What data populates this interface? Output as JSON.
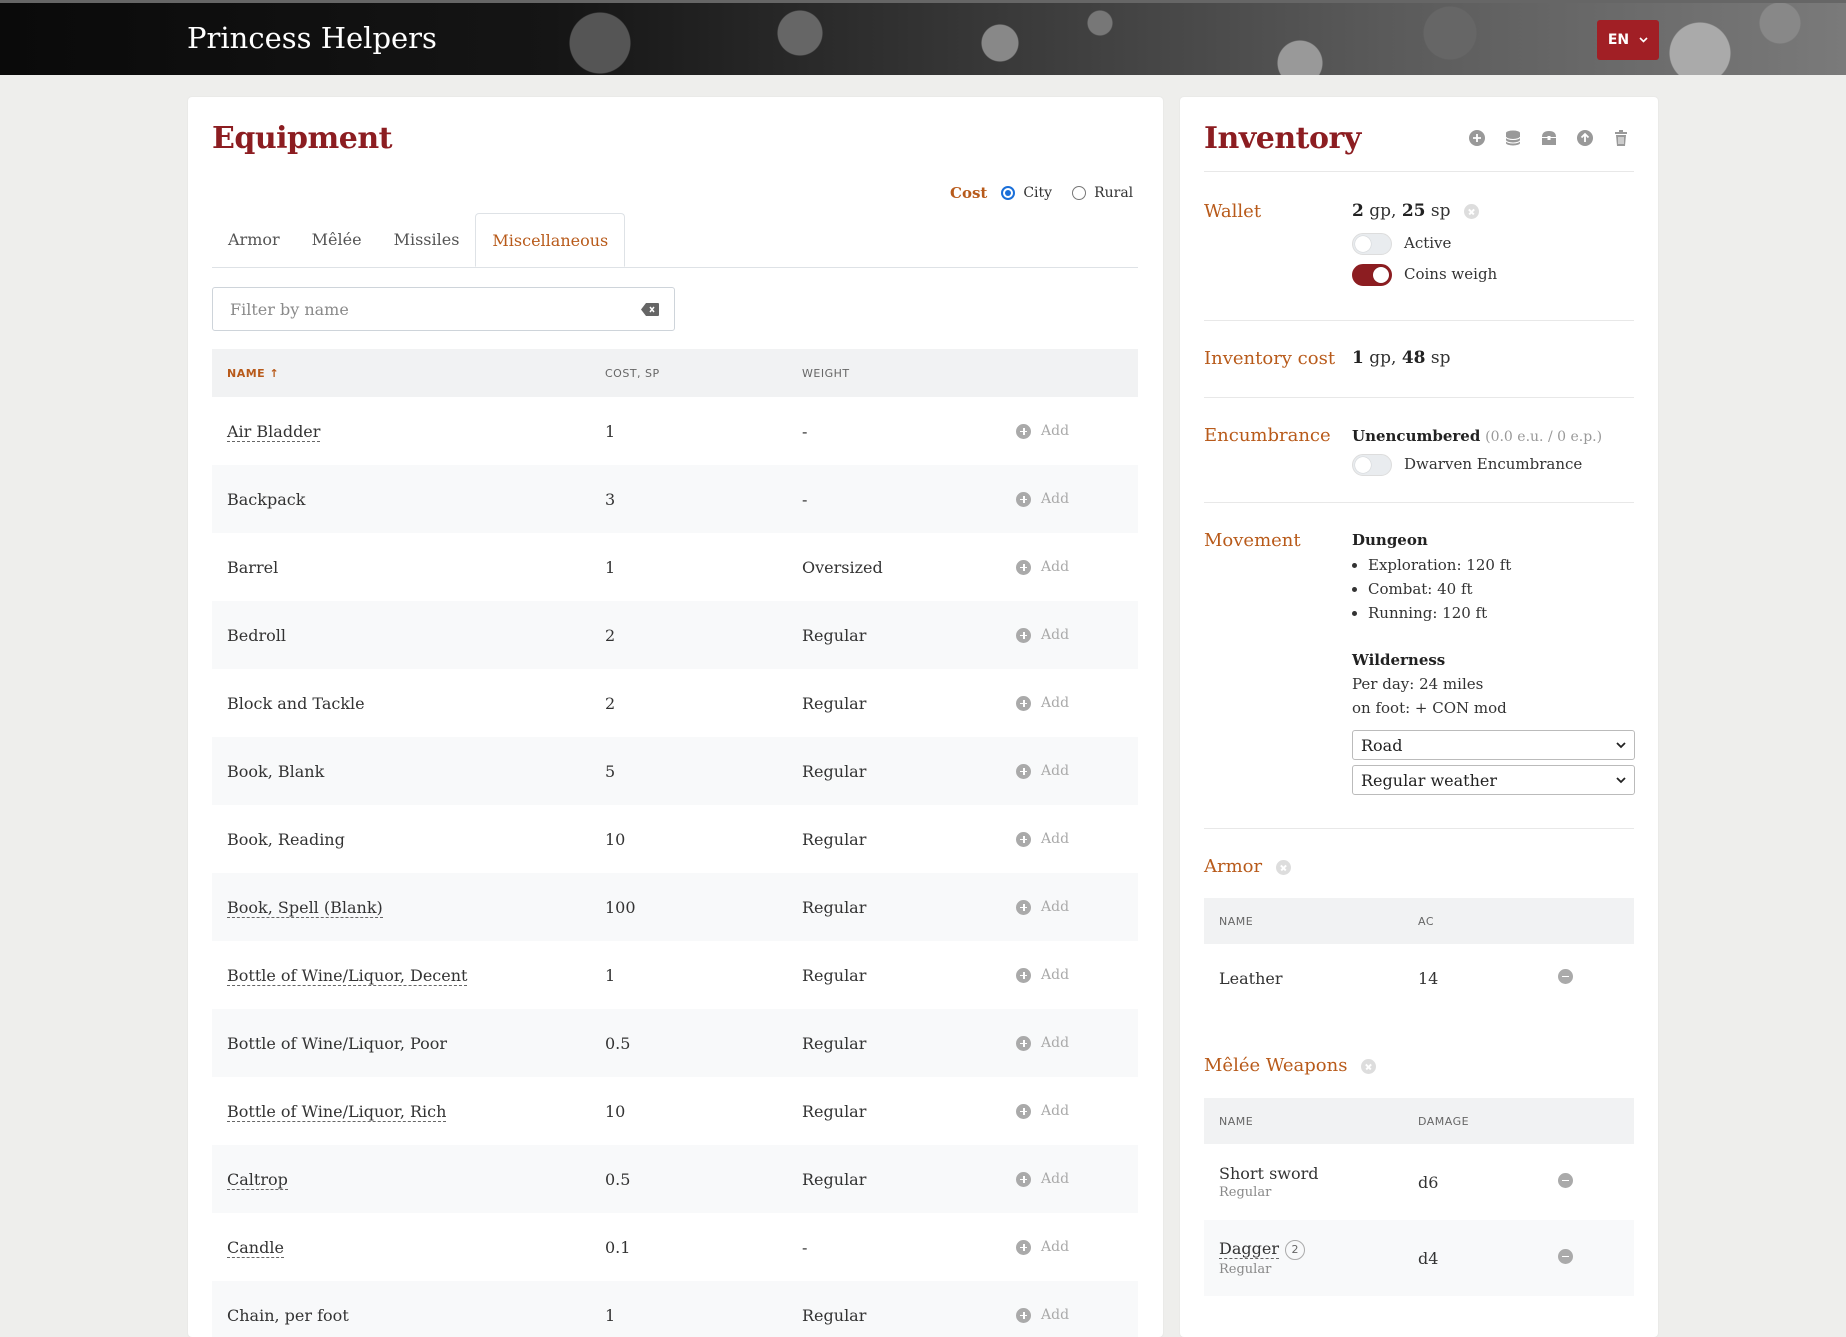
{
  "header": {
    "brand": "Princess Helpers",
    "lang": "EN"
  },
  "equipment": {
    "title": "Equipment",
    "cost_label": "Cost",
    "cost_options": [
      {
        "label": "City",
        "selected": true
      },
      {
        "label": "Rural",
        "selected": false
      }
    ],
    "tabs": [
      {
        "label": "Armor",
        "active": false
      },
      {
        "label": "Mêlée",
        "active": false
      },
      {
        "label": "Missiles",
        "active": false
      },
      {
        "label": "Miscellaneous",
        "active": true
      }
    ],
    "filter_placeholder": "Filter by name",
    "columns": {
      "name": "NAME ↑",
      "cost": "COST, SP",
      "weight": "WEIGHT"
    },
    "add_label": "Add",
    "rows": [
      {
        "name": "Air Bladder",
        "cost": "1",
        "weight": "-",
        "tooltip": true
      },
      {
        "name": "Backpack",
        "cost": "3",
        "weight": "-",
        "tooltip": false
      },
      {
        "name": "Barrel",
        "cost": "1",
        "weight": "Oversized",
        "tooltip": false
      },
      {
        "name": "Bedroll",
        "cost": "2",
        "weight": "Regular",
        "tooltip": false
      },
      {
        "name": "Block and Tackle",
        "cost": "2",
        "weight": "Regular",
        "tooltip": false
      },
      {
        "name": "Book, Blank",
        "cost": "5",
        "weight": "Regular",
        "tooltip": false
      },
      {
        "name": "Book, Reading",
        "cost": "10",
        "weight": "Regular",
        "tooltip": false
      },
      {
        "name": "Book, Spell (Blank)",
        "cost": "100",
        "weight": "Regular",
        "tooltip": true
      },
      {
        "name": "Bottle of Wine/Liquor, Decent",
        "cost": "1",
        "weight": "Regular",
        "tooltip": true
      },
      {
        "name": "Bottle of Wine/Liquor, Poor",
        "cost": "0.5",
        "weight": "Regular",
        "tooltip": false
      },
      {
        "name": "Bottle of Wine/Liquor, Rich",
        "cost": "10",
        "weight": "Regular",
        "tooltip": true
      },
      {
        "name": "Caltrop",
        "cost": "0.5",
        "weight": "Regular",
        "tooltip": true
      },
      {
        "name": "Candle",
        "cost": "0.1",
        "weight": "-",
        "tooltip": true
      },
      {
        "name": "Chain, per foot",
        "cost": "1",
        "weight": "Regular",
        "tooltip": false
      }
    ]
  },
  "inventory": {
    "title": "Inventory",
    "icons": [
      "plus-circle-icon",
      "coins-icon",
      "chest-icon",
      "upload-icon",
      "trash-icon"
    ],
    "wallet": {
      "label": "Wallet",
      "gp": "2",
      "gp_unit": "gp,",
      "sp": "25",
      "sp_unit": "sp",
      "active_label": "Active",
      "active_on": false,
      "coins_weigh_label": "Coins weigh",
      "coins_weigh_on": true
    },
    "cost": {
      "label": "Inventory cost",
      "gp": "1",
      "gp_unit": "gp,",
      "sp": "48",
      "sp_unit": "sp"
    },
    "encumbrance": {
      "label": "Encumbrance",
      "status": "Unencumbered",
      "detail": "(0.0 e.u. / 0 e.p.)",
      "dwarven_label": "Dwarven Encumbrance",
      "dwarven_on": false
    },
    "movement": {
      "label": "Movement",
      "dungeon_title": "Dungeon",
      "dungeon_items": [
        "Exploration: 120 ft",
        "Combat: 40 ft",
        "Running: 120 ft"
      ],
      "wilderness_title": "Wilderness",
      "per_day": "Per day: 24 miles",
      "on_foot": "on foot: + CON mod",
      "terrain": "Road",
      "weather": "Regular weather"
    },
    "armor": {
      "label": "Armor",
      "col_name": "NAME",
      "col_ac": "AC",
      "rows": [
        {
          "name": "Leather",
          "ac": "14"
        }
      ]
    },
    "melee": {
      "label": "Mêlée Weapons",
      "col_name": "NAME",
      "col_damage": "DAMAGE",
      "rows": [
        {
          "name": "Short sword",
          "sub": "Regular",
          "damage": "d6",
          "count": ""
        },
        {
          "name": "Dagger",
          "sub": "Regular",
          "damage": "d4",
          "count": "2"
        }
      ]
    }
  }
}
